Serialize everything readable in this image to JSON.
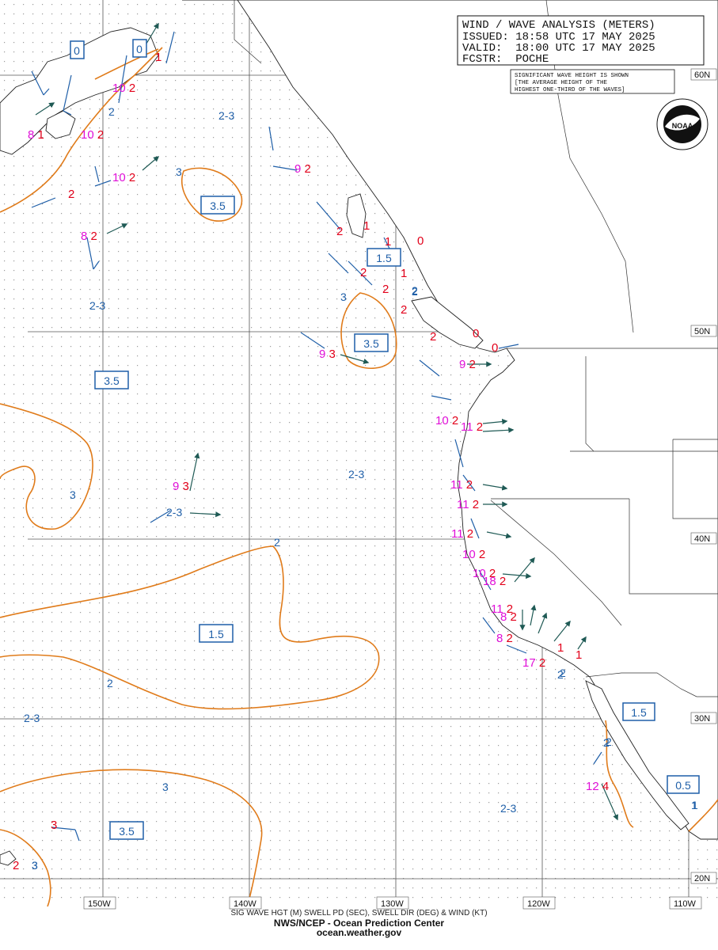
{
  "header": {
    "title": "WIND / WAVE ANALYSIS (METERS)",
    "issued": "ISSUED: 18:58 UTC 17 MAY 2025",
    "valid": "VALID:  18:00 UTC 17 MAY 2025",
    "forecaster": "FCSTR:  POCHE"
  },
  "note": [
    "SIGNIFICANT WAVE HEIGHT IS SHOWN",
    "[THE AVERAGE HEIGHT OF THE",
    "HIGHEST ONE-THIRD OF THE WAVES]"
  ],
  "logo": {
    "text": "NOAA",
    "ring": "NATIONAL OCEANIC AND ATMOSPHERIC ADMINISTRATION · U.S. DEPARTMENT OF COMMERCE"
  },
  "lat_labels": [
    "60N",
    "50N",
    "40N",
    "30N",
    "20N"
  ],
  "lon_labels": [
    "150W",
    "140W",
    "130W",
    "120W",
    "110W"
  ],
  "contour_labels": [
    "2",
    "3",
    "2",
    "3",
    "3",
    "2",
    "2",
    "3",
    "3",
    "2",
    "2",
    "1"
  ],
  "boxed_values": [
    "0",
    "0",
    "3.5",
    "1.5",
    "3.5",
    "3.5",
    "1.5",
    "1.5",
    "0.5",
    "3.5"
  ],
  "region_labels": [
    "2-3",
    "2-3",
    "2-3",
    "2-3",
    "2-3",
    "2-3"
  ],
  "obs": [
    {
      "period": "10",
      "height": "2"
    },
    {
      "period": "8",
      "height": "1"
    },
    {
      "period": "10",
      "height": "2"
    },
    {
      "period": "10",
      "height": "2"
    },
    {
      "period": "8",
      "height": "2"
    },
    {
      "period": "9",
      "height": "2"
    },
    {
      "period": "9",
      "height": "3"
    },
    {
      "period": "10",
      "height": "2"
    },
    {
      "period": "9",
      "height": "2"
    },
    {
      "period": "9",
      "height": "3"
    },
    {
      "period": "11",
      "height": "2"
    },
    {
      "period": "11",
      "height": "2"
    },
    {
      "period": "11",
      "height": "2"
    },
    {
      "period": "11",
      "height": "2"
    },
    {
      "period": "10",
      "height": "2"
    },
    {
      "period": "10",
      "height": "2"
    },
    {
      "period": "18",
      "height": "2"
    },
    {
      "period": "11",
      "height": "2"
    },
    {
      "period": "8",
      "height": "2"
    },
    {
      "period": "8",
      "height": "2"
    },
    {
      "period": "17",
      "height": "2"
    },
    {
      "period": "12",
      "height": "4"
    }
  ],
  "lone_red": [
    "1",
    "2",
    "1",
    "2",
    "1",
    "2",
    "2",
    "2",
    "0",
    "0",
    "0",
    "2",
    "1",
    "1",
    "1",
    "3",
    "2"
  ],
  "lone_blue": [
    "2",
    "2",
    "2",
    "1",
    "3"
  ],
  "footer": {
    "line1": "SIG WAVE HGT (M) SWELL PD (SEC), SWELL DIR (DEG) & WIND (KT)",
    "line2": "NWS/NCEP - Ocean Prediction Center",
    "line3": "ocean.weather.gov"
  },
  "colors": {
    "contour": "#e07b1a",
    "blue_text": "#1f5fa8",
    "height_red": "#e2001a",
    "period_magenta": "#e010d8",
    "arrow": "#1f5a55",
    "land": "#222222",
    "grid": "#555555"
  }
}
